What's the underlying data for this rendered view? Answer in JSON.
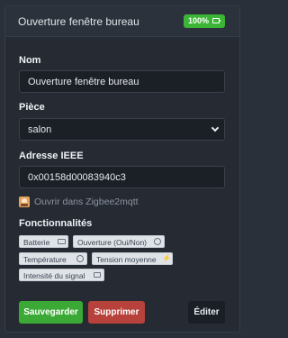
{
  "header": {
    "title": "Ouverture fenêtre bureau",
    "battery_percent": "100%",
    "battery_color": "#3bb536"
  },
  "form": {
    "name_label": "Nom",
    "name_value": "Ouverture fenêtre bureau",
    "room_label": "Pièce",
    "room_value": "salon",
    "ieee_label": "Adresse IEEE",
    "ieee_value": "0x00158d00083940c3",
    "zigbee_link": "Ouvrir dans Zigbee2mqtt"
  },
  "features": {
    "label": "Fonctionnalités",
    "items": [
      {
        "label": "Batterie",
        "icon": "battery-icon"
      },
      {
        "label": "Ouverture (Oui/Non)",
        "icon": "toggle-icon"
      },
      {
        "label": "Température",
        "icon": "gear-icon"
      },
      {
        "label": "Tension moyenne",
        "icon": "bolt-icon"
      },
      {
        "label": "Intensité du signal",
        "icon": "signal-icon"
      }
    ]
  },
  "actions": {
    "save": "Sauvegarder",
    "delete": "Supprimer",
    "edit": "Éditer",
    "save_color": "#3aa935",
    "delete_color": "#b7413b"
  }
}
